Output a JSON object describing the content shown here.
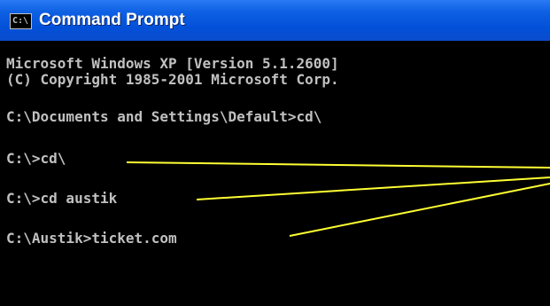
{
  "window": {
    "title": "Command Prompt",
    "icon": "cmd-icon",
    "icon_glyph": "C:\\"
  },
  "console": {
    "lines": [
      "Microsoft Windows XP [Version 5.1.2600]",
      "(C) Copyright 1985-2001 Microsoft Corp.",
      "C:\\Documents and Settings\\Default>cd\\",
      "C:\\>cd\\",
      "C:\\>cd austik",
      "C:\\Austik>ticket.com"
    ],
    "text_color": "#c0c0c0",
    "background_color": "#000000"
  },
  "annotation": {
    "line_color": "#ffff33"
  }
}
